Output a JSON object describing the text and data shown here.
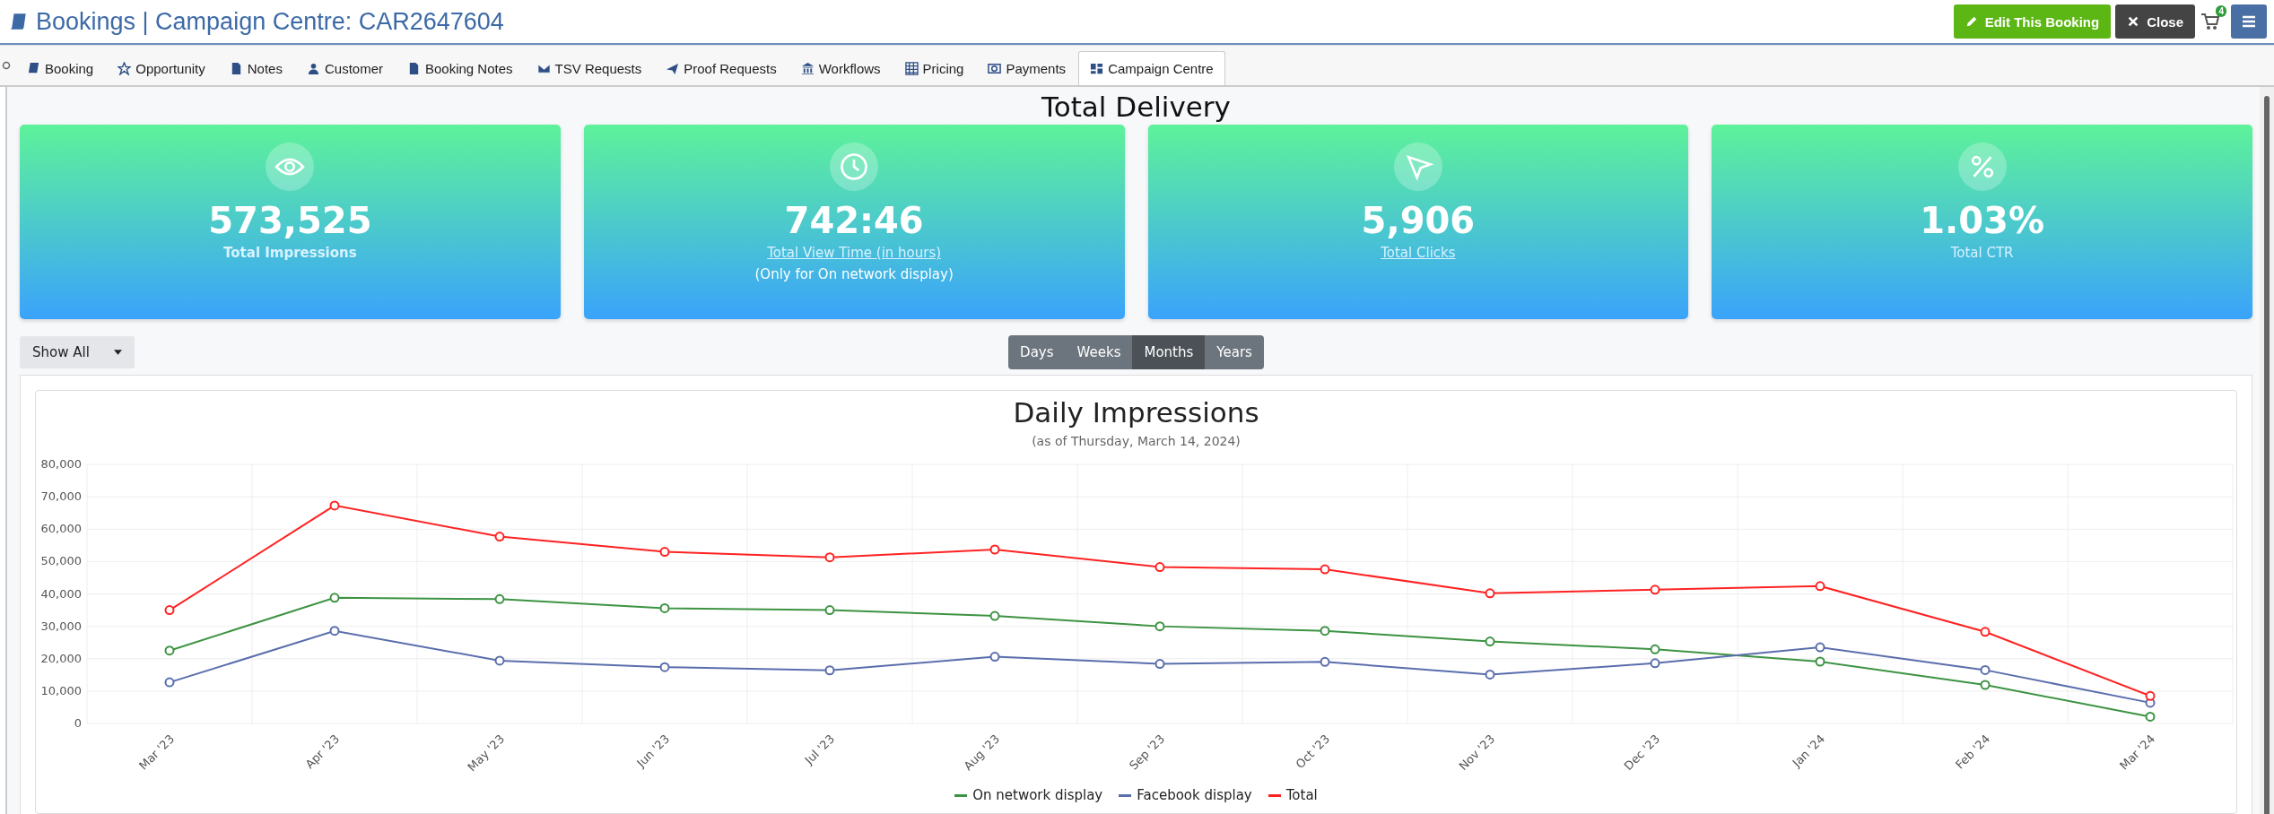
{
  "window": {
    "title": "Bookings | Campaign Centre: CAR2647604"
  },
  "header_buttons": [
    {
      "label": "Edit This Booking",
      "kind": "edit"
    },
    {
      "label": "Close",
      "kind": "close"
    }
  ],
  "cart": {
    "badge": "4"
  },
  "tabs": [
    {
      "label": "Booking",
      "selected": false
    },
    {
      "label": "Opportunity",
      "selected": false
    },
    {
      "label": "Notes",
      "selected": false
    },
    {
      "label": "Customer",
      "selected": false
    },
    {
      "label": "Booking Notes",
      "selected": false
    },
    {
      "label": "TSV Requests",
      "selected": false
    },
    {
      "label": "Proof Requests",
      "selected": false
    },
    {
      "label": "Workflows",
      "selected": false
    },
    {
      "label": "Pricing",
      "selected": false
    },
    {
      "label": "Payments",
      "selected": false
    },
    {
      "label": "Campaign Centre",
      "selected": true
    }
  ],
  "heading": "Total Delivery",
  "cards": [
    {
      "value": "573,525",
      "label": "Total Impressions",
      "link": false,
      "bold": true
    },
    {
      "value": "742:46",
      "label": "Total View Time (in hours)",
      "link": true,
      "bold": false,
      "note": "(Only for On network display)"
    },
    {
      "value": "5,906",
      "label": "Total Clicks",
      "link": true,
      "bold": false
    },
    {
      "value": "1.03%",
      "label": "Total CTR",
      "link": false,
      "bold": false
    }
  ],
  "filter": {
    "value": "Show All"
  },
  "periods": [
    {
      "label": "Days",
      "selected": false
    },
    {
      "label": "Weeks",
      "selected": false
    },
    {
      "label": "Months",
      "selected": true
    },
    {
      "label": "Years",
      "selected": false
    }
  ],
  "chart": {
    "subtitle": "(as of Thursday, March 14, 2024)",
    "chart_data": {
      "type": "line",
      "title": "Daily Impressions",
      "categories": [
        "Mar '23",
        "Apr '23",
        "May '23",
        "Jun '23",
        "Jul '23",
        "Aug '23",
        "Sep '23",
        "Oct '23",
        "Nov '23",
        "Dec '23",
        "Jan '24",
        "Feb '24",
        "Mar '24"
      ],
      "ylim": [
        0,
        80000
      ],
      "yticks": [
        {
          "value": 0,
          "label": "0"
        },
        {
          "value": 10000,
          "label": "10,000"
        },
        {
          "value": 20000,
          "label": "20,000"
        },
        {
          "value": 30000,
          "label": "30,000"
        },
        {
          "value": 40000,
          "label": "40,000"
        },
        {
          "value": 50000,
          "label": "50,000"
        },
        {
          "value": 60000,
          "label": "60,000"
        },
        {
          "value": 70000,
          "label": "70,000"
        },
        {
          "value": 80000,
          "label": "80,000"
        }
      ],
      "grid": true,
      "legend": "bottom",
      "series": [
        {
          "name": "On network display",
          "color": "#3d9343",
          "marker": "circle",
          "values": [
            22500,
            38800,
            38400,
            35600,
            35000,
            33200,
            30000,
            28600,
            25300,
            22900,
            19100,
            11900,
            2100
          ]
        },
        {
          "name": "Facebook display",
          "color": "#5a6eac",
          "marker": "circle",
          "values": [
            12700,
            28600,
            19400,
            17400,
            16400,
            20600,
            18400,
            19000,
            15100,
            18600,
            23500,
            16500,
            6400
          ]
        },
        {
          "name": "Total",
          "color": "#ff2222",
          "marker": "circle",
          "values": [
            35000,
            67300,
            57700,
            53000,
            51300,
            53700,
            48300,
            47600,
            40200,
            41300,
            42400,
            28300,
            8500
          ]
        }
      ]
    }
  }
}
